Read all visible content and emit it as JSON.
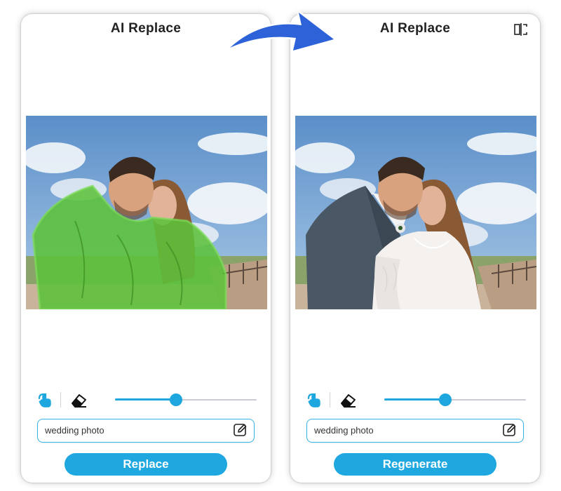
{
  "left_panel": {
    "title": "AI Replace",
    "prompt": {
      "value": "wedding photo"
    },
    "brush_size_fraction": 0.43,
    "action_label": "Replace",
    "mask_color": "#5cc23a"
  },
  "right_panel": {
    "title": "AI Replace",
    "prompt": {
      "value": "wedding photo"
    },
    "brush_size_fraction": 0.43,
    "action_label": "Regenerate"
  },
  "icons": {
    "brush": "brush-tool-icon",
    "eraser": "eraser-icon",
    "edit": "edit-icon",
    "compare": "compare-icon",
    "arrow": "curved-arrow"
  },
  "colors": {
    "accent": "#1fa8e0",
    "arrow": "#2e62d9"
  }
}
